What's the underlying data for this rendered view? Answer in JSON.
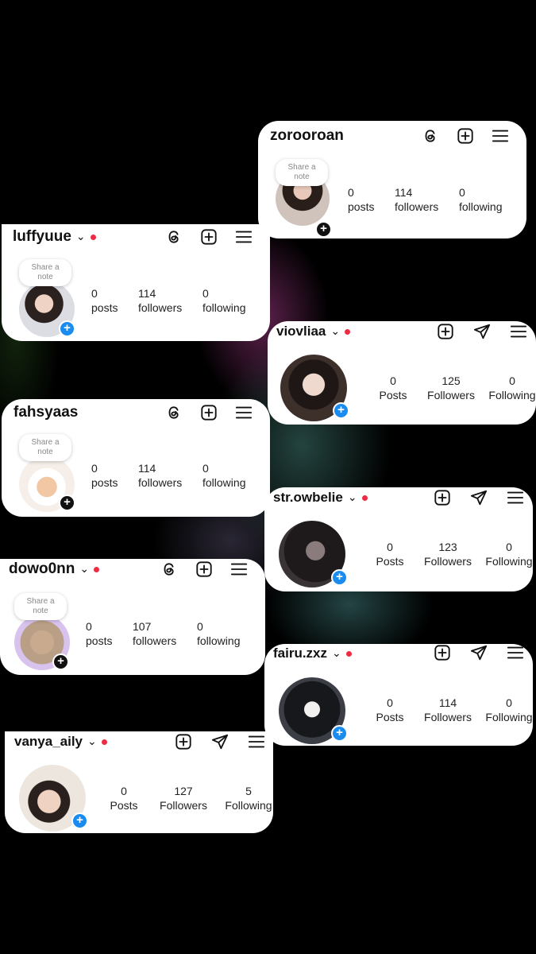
{
  "profiles": [
    {
      "username": "zorooroan",
      "note": "Share a note",
      "stats": [
        {
          "value": "0",
          "label": "posts"
        },
        {
          "value": "114",
          "label": "followers"
        },
        {
          "value": "0",
          "label": "following"
        }
      ],
      "icons": [
        "threads-icon",
        "create-post-icon",
        "menu-icon"
      ]
    },
    {
      "username": "luffyuue",
      "note": "Share a note",
      "stats": [
        {
          "value": "0",
          "label": "posts"
        },
        {
          "value": "114",
          "label": "followers"
        },
        {
          "value": "0",
          "label": "following"
        }
      ],
      "icons": [
        "threads-icon",
        "create-post-icon",
        "menu-icon"
      ]
    },
    {
      "username": "viovliaa",
      "stats": [
        {
          "value": "0",
          "label": "Posts"
        },
        {
          "value": "125",
          "label": "Followers"
        },
        {
          "value": "0",
          "label": "Following"
        }
      ],
      "icons": [
        "create-post-icon",
        "send-icon",
        "menu-icon"
      ]
    },
    {
      "username": "fahsyaas",
      "note": "Share a note",
      "stats": [
        {
          "value": "0",
          "label": "posts"
        },
        {
          "value": "114",
          "label": "followers"
        },
        {
          "value": "0",
          "label": "following"
        }
      ],
      "icons": [
        "threads-icon",
        "create-post-icon",
        "menu-icon"
      ]
    },
    {
      "username": "str.owbelie",
      "stats": [
        {
          "value": "0",
          "label": "Posts"
        },
        {
          "value": "123",
          "label": "Followers"
        },
        {
          "value": "0",
          "label": "Following"
        }
      ],
      "icons": [
        "create-post-icon",
        "send-icon",
        "menu-icon"
      ]
    },
    {
      "username": "dowo0nn",
      "note": "Share a note",
      "stats": [
        {
          "value": "0",
          "label": "posts"
        },
        {
          "value": "107",
          "label": "followers"
        },
        {
          "value": "0",
          "label": "following"
        }
      ],
      "icons": [
        "threads-icon",
        "create-post-icon",
        "menu-icon"
      ]
    },
    {
      "username": "fairu.zxz",
      "stats": [
        {
          "value": "0",
          "label": "Posts"
        },
        {
          "value": "114",
          "label": "Followers"
        },
        {
          "value": "0",
          "label": "Following"
        }
      ],
      "icons": [
        "create-post-icon",
        "send-icon",
        "menu-icon"
      ]
    },
    {
      "username": "vanya_aily",
      "stats": [
        {
          "value": "0",
          "label": "Posts"
        },
        {
          "value": "127",
          "label": "Followers"
        },
        {
          "value": "5",
          "label": "Following"
        }
      ],
      "icons": [
        "create-post-icon",
        "send-icon",
        "menu-icon"
      ]
    }
  ],
  "colors": {
    "background": "#000000",
    "card": "#ffffff",
    "notification_dot": "#ed2c43",
    "add_story_blue": "#1a8cf0"
  }
}
